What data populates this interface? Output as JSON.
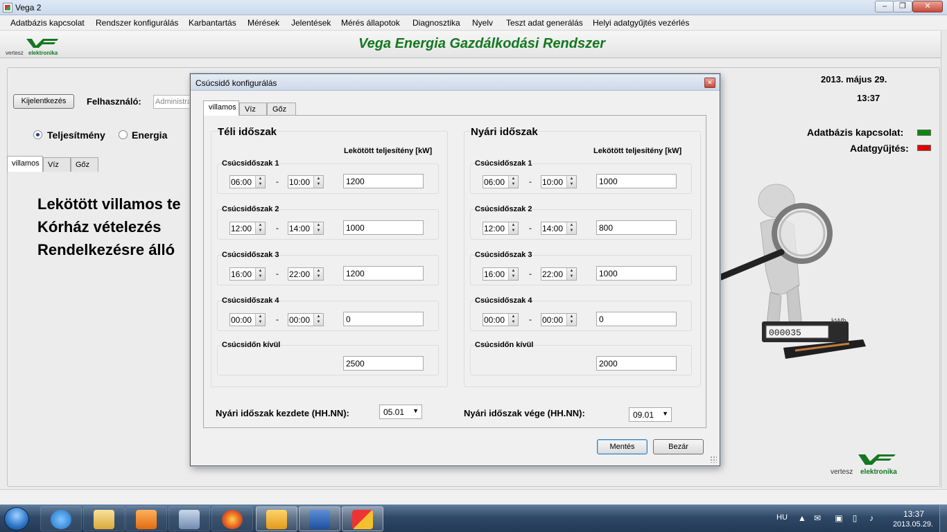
{
  "window": {
    "title": "Vega 2"
  },
  "menu": [
    "Adatbázis kapcsolat",
    "Rendszer konfigurálás",
    "Karbantartás",
    "Mérések",
    "Jelentések",
    "Mérés állapotok",
    "Diagnosztika",
    "Nyelv",
    "Teszt adat generálás",
    "Helyi adatgyűjtés vezérlés"
  ],
  "header": {
    "app_title": "Vega Energia Gazdálkodási Rendszer",
    "logo_word1": "vertesz",
    "logo_word2": "elektronika"
  },
  "main": {
    "logout_label": "Kijelentkezés",
    "user_label": "Felhasználó:",
    "user_value": "Administrator",
    "date": "2013. május 29.",
    "time": "13:37",
    "radio_power": "Teljesítmény",
    "radio_energy": "Energia",
    "db_status_label": "Adatbázis kapcsolat:",
    "collect_status_label": "Adatgyűjtés:",
    "status_colors": {
      "db": "#0a8a0a",
      "collect": "#e00000"
    },
    "tabs": [
      "villamos",
      "Víz",
      "Gőz"
    ],
    "lines": [
      "Lekötött villamos te",
      "Kórház vételezés",
      "Rendelkezésre álló"
    ],
    "meter_unit": "kWh"
  },
  "dialog": {
    "title": "Csúcsidő konfigurálás",
    "tabs": [
      "villamos",
      "Víz",
      "Gőz"
    ],
    "column_header": "Lekötött teljesítény  [kW]",
    "winter": {
      "title": "Téli időszak",
      "periods": [
        {
          "label": "Csúcsidőszak  1",
          "from": "06:00",
          "to": "10:00",
          "value": "1200"
        },
        {
          "label": "Csúcsidőszak  2",
          "from": "12:00",
          "to": "14:00",
          "value": "1000"
        },
        {
          "label": "Csúcsidőszak  3",
          "from": "16:00",
          "to": "22:00",
          "value": "1200"
        },
        {
          "label": "Csúcsidőszak  4",
          "from": "00:00",
          "to": "00:00",
          "value": "0"
        }
      ],
      "offpeak": {
        "label": "Csúcsidőn kívül",
        "value": "2500"
      }
    },
    "summer": {
      "title": "Nyári időszak",
      "periods": [
        {
          "label": "Csúcsidőszak  1",
          "from": "06:00",
          "to": "10:00",
          "value": "1000"
        },
        {
          "label": "Csúcsidőszak  2",
          "from": "12:00",
          "to": "14:00",
          "value": "800"
        },
        {
          "label": "Csúcsidőszak  3",
          "from": "16:00",
          "to": "22:00",
          "value": "1000"
        },
        {
          "label": "Csúcsidőszak  4",
          "from": "00:00",
          "to": "00:00",
          "value": "0"
        }
      ],
      "offpeak": {
        "label": "Csúcsidőn kívül",
        "value": "2000"
      }
    },
    "summer_start_label": "Nyári időszak kezdete (HH.NN):",
    "summer_start_value": "05.01",
    "summer_end_label": "Nyári időszak vége (HH.NN):",
    "summer_end_value": "09.01",
    "save_label": "Mentés",
    "close_label": "Bezár"
  },
  "taskbar": {
    "lang": "HU",
    "time": "13:37",
    "date": "2013.05.29."
  }
}
